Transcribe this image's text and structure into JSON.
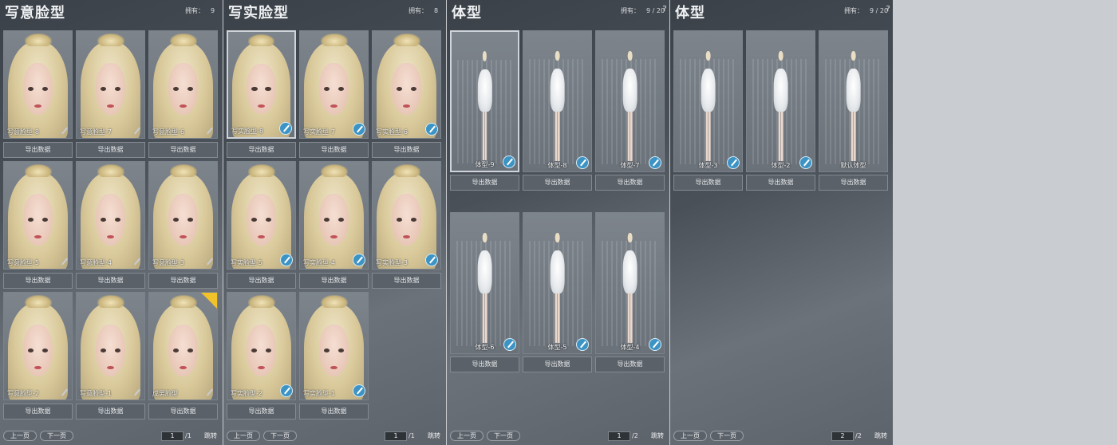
{
  "panels": [
    {
      "title": "写意脸型",
      "owned_label": "拥有：",
      "owned_value": "9",
      "show_help": false,
      "kind": "face",
      "slots": [
        {
          "name": "写意脸型-8",
          "tag": false,
          "selected": false
        },
        {
          "name": "写意脸型-7",
          "tag": false,
          "selected": false
        },
        {
          "name": "写意脸型-6",
          "tag": false,
          "selected": false
        },
        {
          "name": "写意脸型-5",
          "tag": false,
          "selected": false
        },
        {
          "name": "写意脸型-4",
          "tag": false,
          "selected": false
        },
        {
          "name": "写意脸型-3",
          "tag": false,
          "selected": false
        },
        {
          "name": "写意脸型-2",
          "tag": false,
          "selected": false
        },
        {
          "name": "写意脸型-1",
          "tag": false,
          "selected": false
        },
        {
          "name": "成男脸型",
          "tag": true,
          "selected": false
        }
      ],
      "brush_style": "small",
      "export_label": "导出数据",
      "page_current": "1",
      "page_total": "/1"
    },
    {
      "title": "写实脸型",
      "owned_label": "拥有：",
      "owned_value": "8",
      "show_help": false,
      "kind": "face",
      "slots": [
        {
          "name": "写实脸型-8",
          "tag": false,
          "selected": true
        },
        {
          "name": "写实脸型-7",
          "tag": false,
          "selected": false
        },
        {
          "name": "写实脸型-6",
          "tag": false,
          "selected": false
        },
        {
          "name": "写实脸型-5",
          "tag": false,
          "selected": false
        },
        {
          "name": "写实脸型-4",
          "tag": false,
          "selected": false
        },
        {
          "name": "写实脸型-3",
          "tag": false,
          "selected": false
        },
        {
          "name": "写实脸型-2",
          "tag": false,
          "selected": false
        },
        {
          "name": "写实脸型-1",
          "tag": false,
          "selected": false
        }
      ],
      "brush_style": "blue",
      "export_label": "导出数据",
      "page_current": "1",
      "page_total": "/1"
    },
    {
      "title": "体型",
      "owned_label": "拥有：",
      "owned_value": "9 / 20",
      "show_help": true,
      "kind": "body",
      "slots": [
        {
          "name": "体型-9",
          "tag": false,
          "selected": true
        },
        {
          "name": "体型-8",
          "tag": false,
          "selected": false
        },
        {
          "name": "体型-7",
          "tag": false,
          "selected": false
        },
        {
          "name": "体型-6",
          "tag": false,
          "selected": false
        },
        {
          "name": "体型-5",
          "tag": false,
          "selected": false
        },
        {
          "name": "体型-4",
          "tag": false,
          "selected": false
        }
      ],
      "brush_style": "blue",
      "export_label": "导出数据",
      "page_current": "1",
      "page_total": "/2"
    },
    {
      "title": "体型",
      "owned_label": "拥有：",
      "owned_value": "9 / 20",
      "show_help": true,
      "kind": "body",
      "slots": [
        {
          "name": "体型-3",
          "tag": false,
          "selected": false
        },
        {
          "name": "体型-2",
          "tag": false,
          "selected": false
        },
        {
          "name": "默认体型",
          "tag": false,
          "selected": false,
          "no_brush": true
        }
      ],
      "brush_style": "blue",
      "export_label": "导出数据",
      "page_current": "2",
      "page_total": "/2"
    }
  ],
  "pager": {
    "prev_label": "上一页",
    "next_label": "下一页",
    "jump_label": "跳转",
    "help_label": "?"
  }
}
